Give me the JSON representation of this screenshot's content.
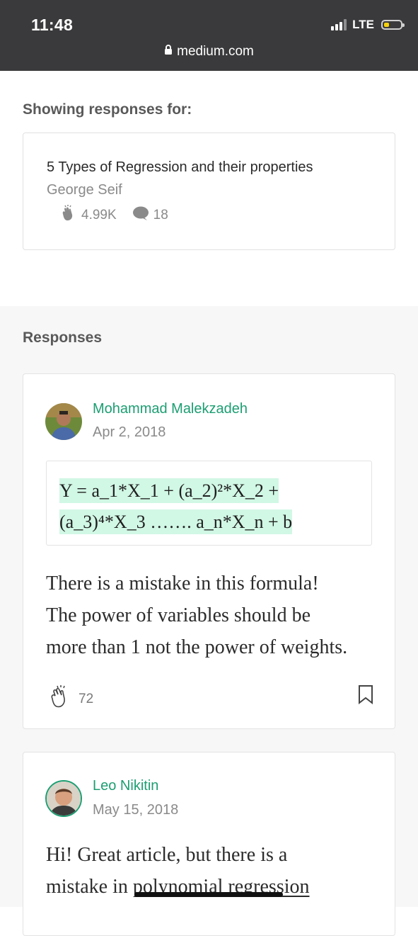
{
  "status_bar": {
    "time": "11:48",
    "network": "LTE"
  },
  "browser": {
    "url": "medium.com"
  },
  "showing_label": "Showing responses for:",
  "article": {
    "title": "5 Types of Regression and their properties",
    "author": "George Seif",
    "claps": "4.99K",
    "responses": "18"
  },
  "responses_heading": "Responses",
  "responses": [
    {
      "author": "Mohammad Malekzadeh",
      "date": "Apr 2, 2018",
      "quote_line1": "Y = a_1*X_1 + (a_2)²*X_2 +",
      "quote_line2": "(a_3)⁴*X_3 ……. a_n*X_n + b",
      "body_line1": "There is a mistake in this formula!",
      "body_line2": "The power of variables should be",
      "body_line3": "more than 1 not the power of weights.",
      "claps": "72"
    },
    {
      "author": "Leo Nikitin",
      "date": "May 15, 2018",
      "body_line1": "Hi! Great article, but there is a",
      "body_line2_prefix": "mistake in ",
      "body_line2_link": "polynomial regression"
    }
  ],
  "colors": {
    "accent": "#1c9e72",
    "highlight": "#d1f7e5",
    "topbar": "#3a3a3c"
  },
  "icons": [
    "lock-icon",
    "clap-icon",
    "comment-icon",
    "bookmark-icon",
    "signal-icon",
    "battery-icon"
  ]
}
